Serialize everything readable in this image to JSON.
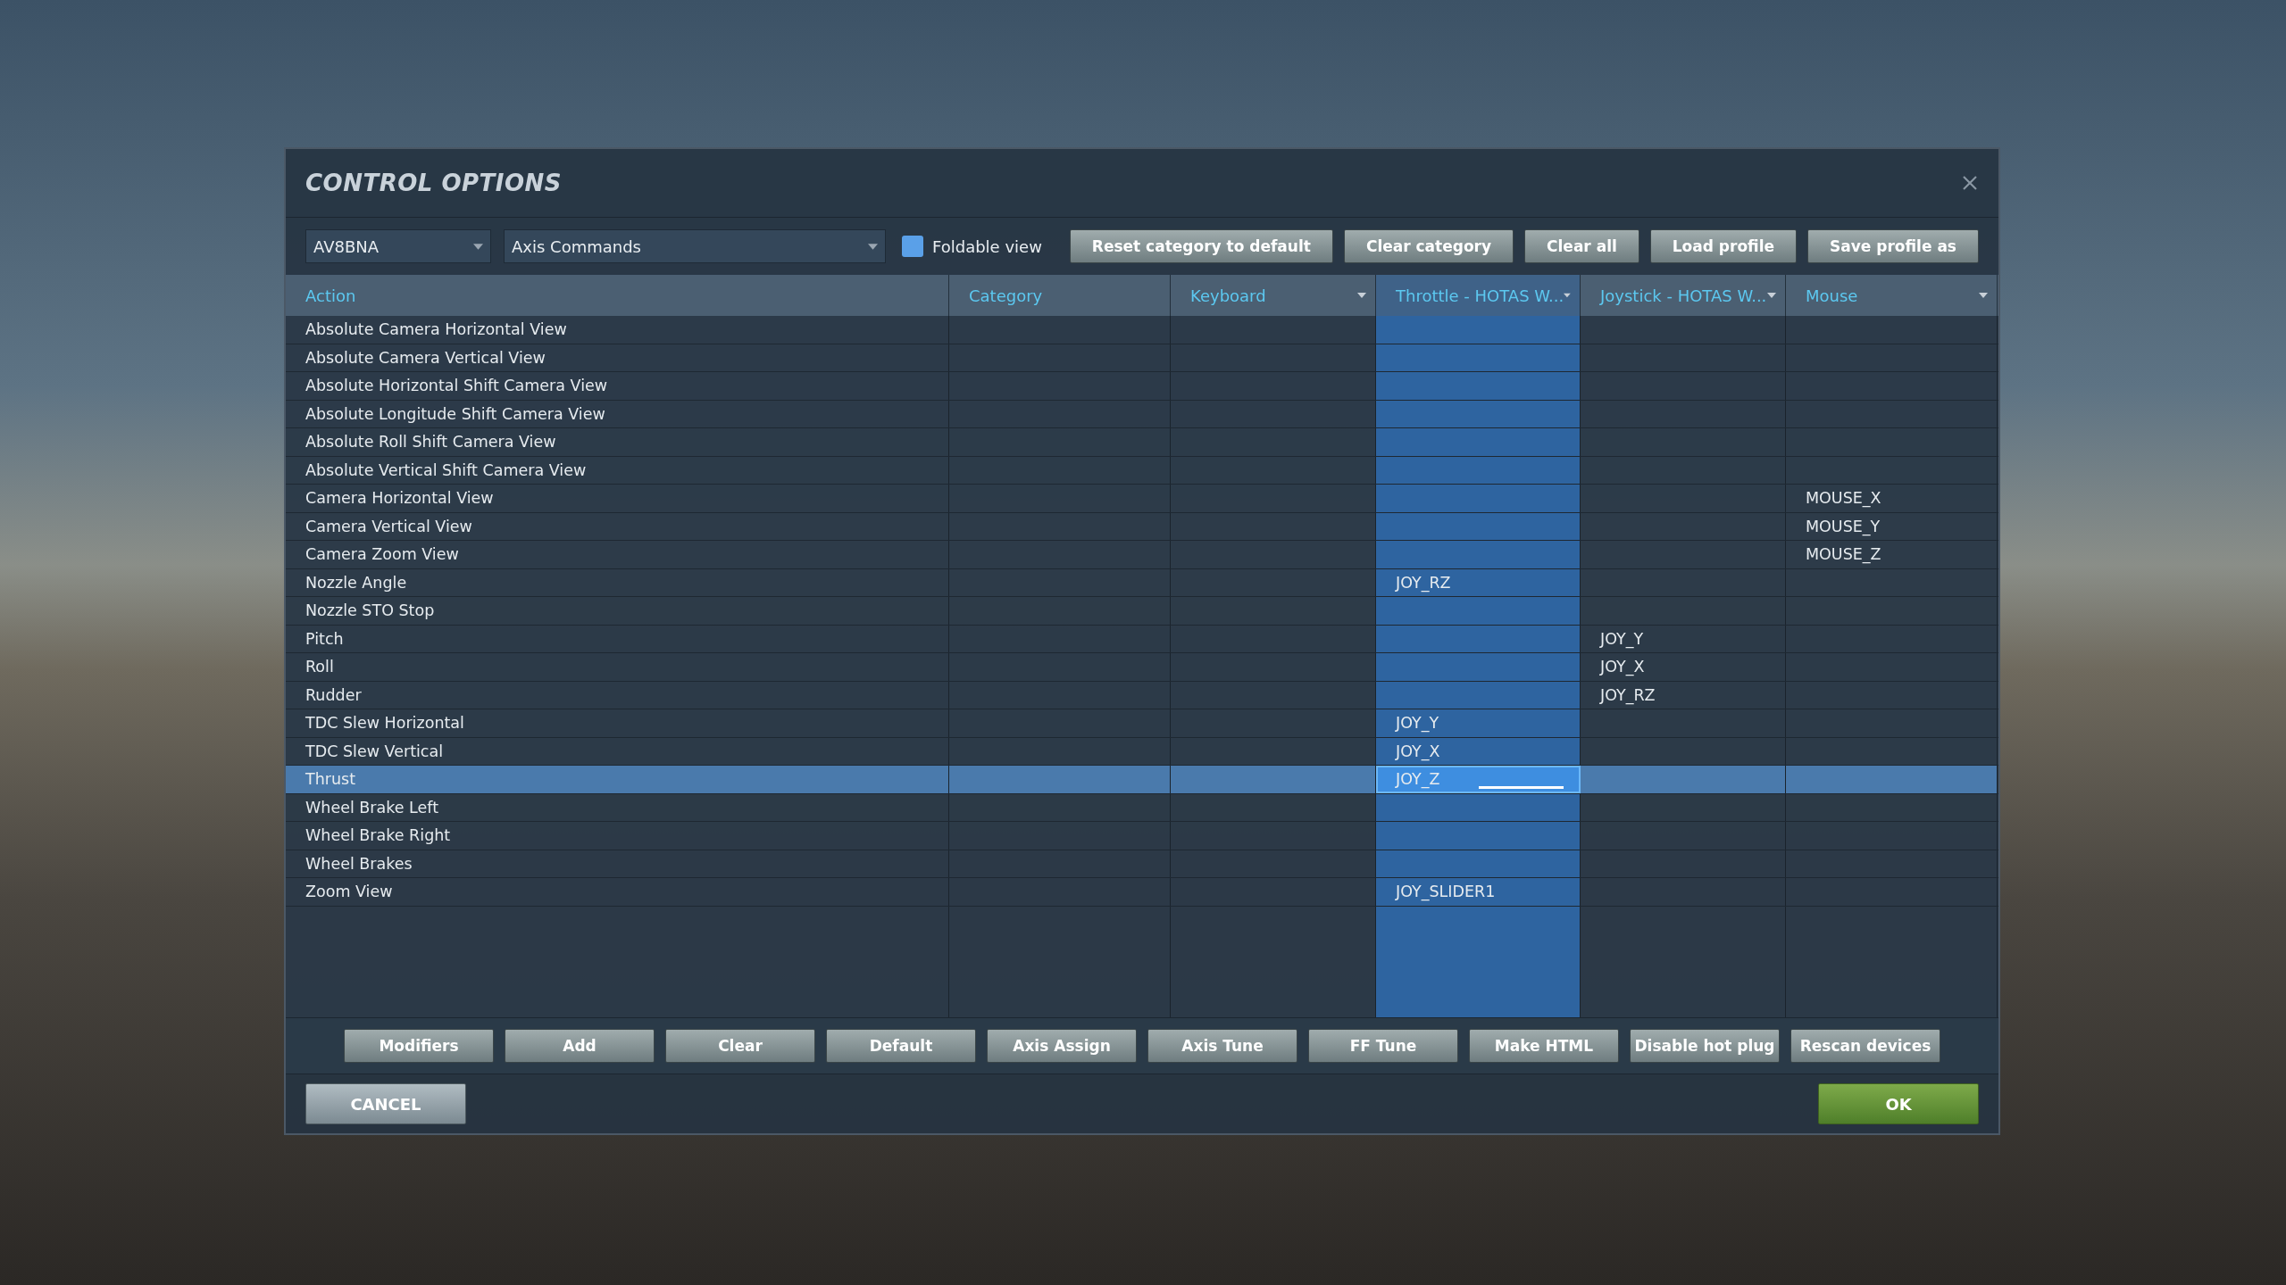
{
  "dialog": {
    "title": "CONTROL OPTIONS"
  },
  "toolbar": {
    "aircraft": "AV8BNA",
    "category": "Axis Commands",
    "foldable_view": {
      "label": "Foldable view",
      "checked": false
    },
    "buttons": [
      "Reset category to default",
      "Clear category",
      "Clear all",
      "Load profile",
      "Save profile as"
    ]
  },
  "table": {
    "columns": [
      {
        "label": "Action",
        "dropdown": false,
        "selected": false
      },
      {
        "label": "Category",
        "dropdown": false,
        "selected": false
      },
      {
        "label": "Keyboard",
        "dropdown": true,
        "selected": false
      },
      {
        "label": "Throttle - HOTAS W...",
        "dropdown": true,
        "selected": true
      },
      {
        "label": "Joystick - HOTAS W...",
        "dropdown": true,
        "selected": false
      },
      {
        "label": "Mouse",
        "dropdown": true,
        "selected": false
      }
    ],
    "rows": [
      {
        "cells": [
          "Absolute Camera Horizontal View",
          "",
          "",
          "",
          "",
          ""
        ],
        "selected": false
      },
      {
        "cells": [
          "Absolute Camera Vertical View",
          "",
          "",
          "",
          "",
          ""
        ],
        "selected": false
      },
      {
        "cells": [
          "Absolute Horizontal Shift Camera View",
          "",
          "",
          "",
          "",
          ""
        ],
        "selected": false
      },
      {
        "cells": [
          "Absolute Longitude Shift Camera View",
          "",
          "",
          "",
          "",
          ""
        ],
        "selected": false
      },
      {
        "cells": [
          "Absolute Roll Shift Camera View",
          "",
          "",
          "",
          "",
          ""
        ],
        "selected": false
      },
      {
        "cells": [
          "Absolute Vertical Shift Camera View",
          "",
          "",
          "",
          "",
          ""
        ],
        "selected": false
      },
      {
        "cells": [
          "Camera Horizontal View",
          "",
          "",
          "",
          "",
          "MOUSE_X"
        ],
        "selected": false
      },
      {
        "cells": [
          "Camera Vertical View",
          "",
          "",
          "",
          "",
          "MOUSE_Y"
        ],
        "selected": false
      },
      {
        "cells": [
          "Camera Zoom View",
          "",
          "",
          "",
          "",
          "MOUSE_Z"
        ],
        "selected": false
      },
      {
        "cells": [
          "Nozzle Angle",
          "",
          "",
          "JOY_RZ",
          "",
          ""
        ],
        "selected": false
      },
      {
        "cells": [
          "Nozzle STO Stop",
          "",
          "",
          "",
          "",
          ""
        ],
        "selected": false
      },
      {
        "cells": [
          "Pitch",
          "",
          "",
          "",
          "JOY_Y",
          ""
        ],
        "selected": false
      },
      {
        "cells": [
          "Roll",
          "",
          "",
          "",
          "JOY_X",
          ""
        ],
        "selected": false
      },
      {
        "cells": [
          "Rudder",
          "",
          "",
          "",
          "JOY_RZ",
          ""
        ],
        "selected": false
      },
      {
        "cells": [
          "TDC Slew Horizontal",
          "",
          "",
          "JOY_Y",
          "",
          ""
        ],
        "selected": false
      },
      {
        "cells": [
          "TDC Slew Vertical",
          "",
          "",
          "JOY_X",
          "",
          ""
        ],
        "selected": false
      },
      {
        "cells": [
          "Thrust",
          "",
          "",
          "JOY_Z",
          "",
          ""
        ],
        "selected": true
      },
      {
        "cells": [
          "Wheel Brake Left",
          "",
          "",
          "",
          "",
          ""
        ],
        "selected": false
      },
      {
        "cells": [
          "Wheel Brake Right",
          "",
          "",
          "",
          "",
          ""
        ],
        "selected": false
      },
      {
        "cells": [
          "Wheel Brakes",
          "",
          "",
          "",
          "",
          ""
        ],
        "selected": false
      },
      {
        "cells": [
          "Zoom View",
          "",
          "",
          "JOY_SLIDER1",
          "",
          ""
        ],
        "selected": false
      }
    ]
  },
  "action_buttons": [
    "Modifiers",
    "Add",
    "Clear",
    "Default",
    "Axis Assign",
    "Axis Tune",
    "FF Tune",
    "Make HTML",
    "Disable hot plug",
    "Rescan devices"
  ],
  "footer": [
    {
      "label": "CANCEL",
      "kind": "secondary"
    },
    {
      "label": "OK",
      "kind": "primary"
    }
  ]
}
